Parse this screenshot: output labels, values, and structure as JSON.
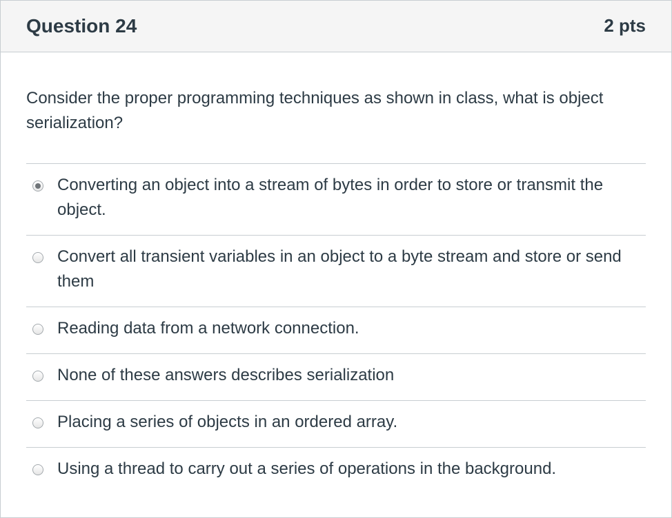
{
  "question": {
    "title": "Question 24",
    "points": "2 pts",
    "text": "Consider the proper programming techniques as shown in class, what is object serialization?"
  },
  "answers": [
    {
      "label": "Converting an object into a stream of bytes in order to store or transmit the object.",
      "selected": true
    },
    {
      "label": "Convert all transient variables in an object to a byte stream and store or send them",
      "selected": false
    },
    {
      "label": "Reading data from a network connection.",
      "selected": false
    },
    {
      "label": "None of these answers describes serialization",
      "selected": false
    },
    {
      "label": "Placing a series of objects in an ordered array.",
      "selected": false
    },
    {
      "label": "Using a thread to carry out a series of operations in the background.",
      "selected": false
    }
  ]
}
